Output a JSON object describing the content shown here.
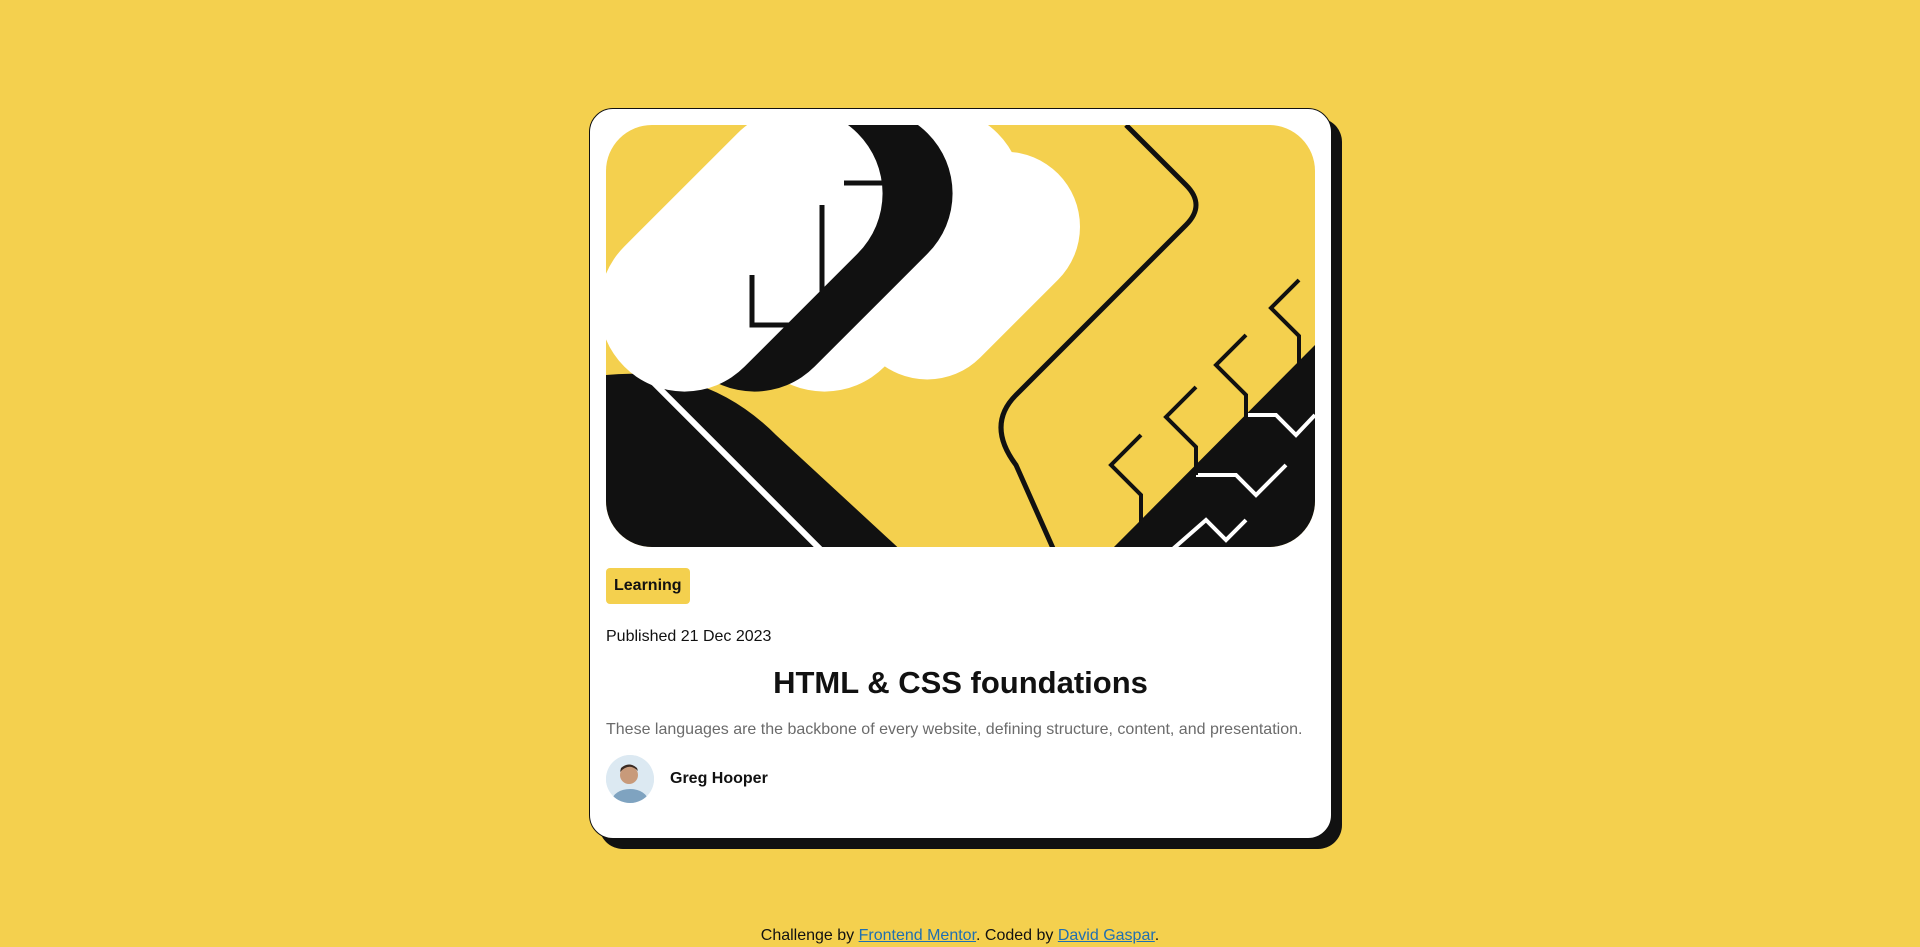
{
  "card": {
    "tag": "Learning",
    "published": "Published 21 Dec 2023",
    "title": "HTML & CSS foundations",
    "description": "These languages are the backbone of every website, defining structure, content, and presentation.",
    "author": "Greg Hooper"
  },
  "footer": {
    "prefix": "Challenge by ",
    "link1": "Frontend Mentor",
    "middle": ". Coded by ",
    "link2": "David Gaspar",
    "suffix": "."
  },
  "colors": {
    "background": "#F4D04E",
    "ink": "#111111",
    "card": "#FFFFFF",
    "muted": "#6B6B6B",
    "link": "#1F6FB2"
  },
  "icons": {
    "hero": "blog-illustration",
    "avatar": "author-avatar"
  }
}
